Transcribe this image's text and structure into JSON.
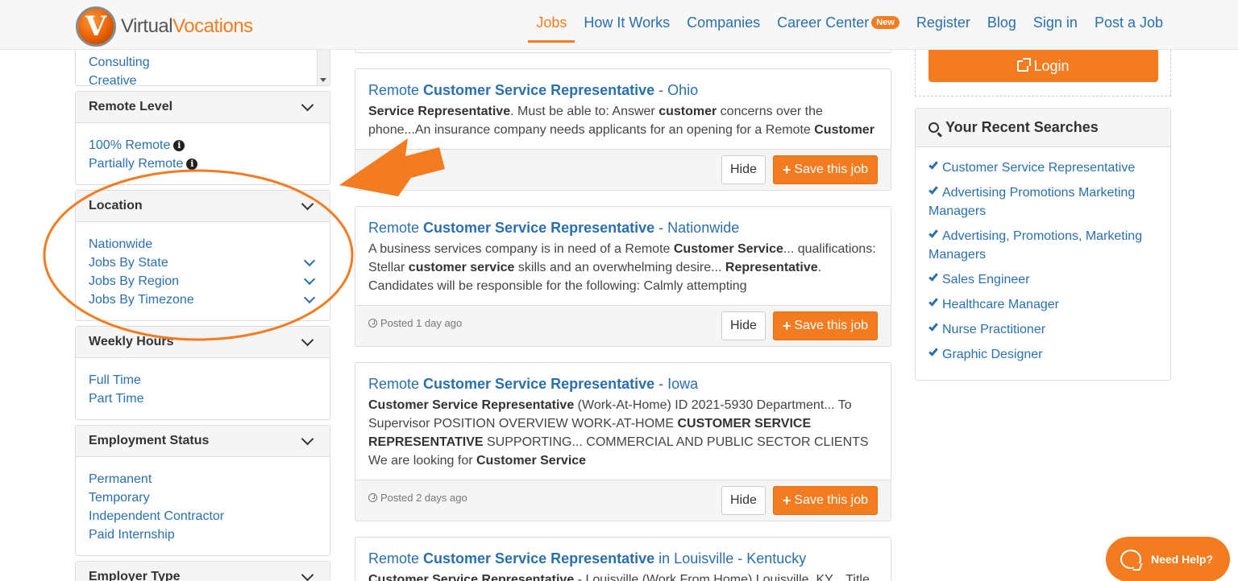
{
  "header": {
    "logo_text_1": "Virtual",
    "logo_text_2": "Vocations",
    "logo_letter": "V",
    "nav": {
      "jobs": "Jobs",
      "how_it_works": "How It Works",
      "companies": "Companies",
      "career_center": "Career Center",
      "career_center_badge": "New",
      "register": "Register",
      "blog": "Blog",
      "sign_in": "Sign in",
      "post_job": "Post a Job"
    }
  },
  "sidebar": {
    "categories": [
      "Consulting",
      "Creative"
    ],
    "remote_level": {
      "title": "Remote Level",
      "items": [
        "100% Remote",
        "Partially Remote"
      ]
    },
    "location": {
      "title": "Location",
      "items": [
        "Nationwide",
        "Jobs By State",
        "Jobs By Region",
        "Jobs By Timezone"
      ]
    },
    "weekly_hours": {
      "title": "Weekly Hours",
      "items": [
        "Full Time",
        "Part Time"
      ]
    },
    "employment_status": {
      "title": "Employment Status",
      "items": [
        "Permanent",
        "Temporary",
        "Independent Contractor",
        "Paid Internship"
      ]
    },
    "employer_type": {
      "title": "Employer Type"
    }
  },
  "jobs": [
    {
      "title_pre": "Remote ",
      "title_bold": "Customer Service Representative",
      "title_post": " - Ohio",
      "desc_html": "<b>Service Representative</b>. Must be able to: Answer <b>customer</b> concerns over the phone...An insurance company needs applicants for an opening for a Remote <b>Customer</b>",
      "posted": ""
    },
    {
      "title_pre": "Remote ",
      "title_bold": "Customer Service Representative",
      "title_post": " - Nationwide",
      "desc_html": "A business services company is in need of a Remote <b>Customer Service</b>... qualifications: Stellar <b>customer service</b> skills and an overwhelming desire... <b>Representative</b>. Candidates will be responsible for the following: Calmly attempting",
      "posted": "Posted 1 day ago"
    },
    {
      "title_pre": "Remote ",
      "title_bold": "Customer Service Representative",
      "title_post": " - Iowa",
      "desc_html": "<b>Customer Service Representative</b> (Work-At-Home) ID 2021-5930 Department... To Supervisor POSITION OVERVIEW WORK-AT-HOME <b>CUSTOMER SERVICE REPRESENTATIVE</b> SUPPORTING... COMMERCIAL AND PUBLIC SECTOR CLIENTS We are looking for <b>Customer Service</b>",
      "posted": "Posted 2 days ago"
    },
    {
      "title_pre": "Remote ",
      "title_bold": "Customer Service Representative",
      "title_post": " in Louisville - Kentucky",
      "desc_html": "<b>Customer Service Representative</b> - Louisville (Work From Home) Louisville, KY... Title",
      "posted": ""
    }
  ],
  "job_actions": {
    "hide": "Hide",
    "save": "Save this job"
  },
  "right": {
    "login": "Login",
    "recent_title": "Your Recent Searches",
    "recent": [
      "Customer Service Representative",
      "Advertising Promotions Marketing Managers",
      "Advertising, Promotions, Marketing Managers",
      "Sales Engineer",
      "Healthcare Manager",
      "Nurse Practitioner",
      "Graphic Designer"
    ]
  },
  "help": {
    "label": "Need Help?"
  },
  "colors": {
    "brand_orange": "#f47c20",
    "link_blue": "#2a6fb0",
    "annotation_orange": "#f47c20"
  }
}
